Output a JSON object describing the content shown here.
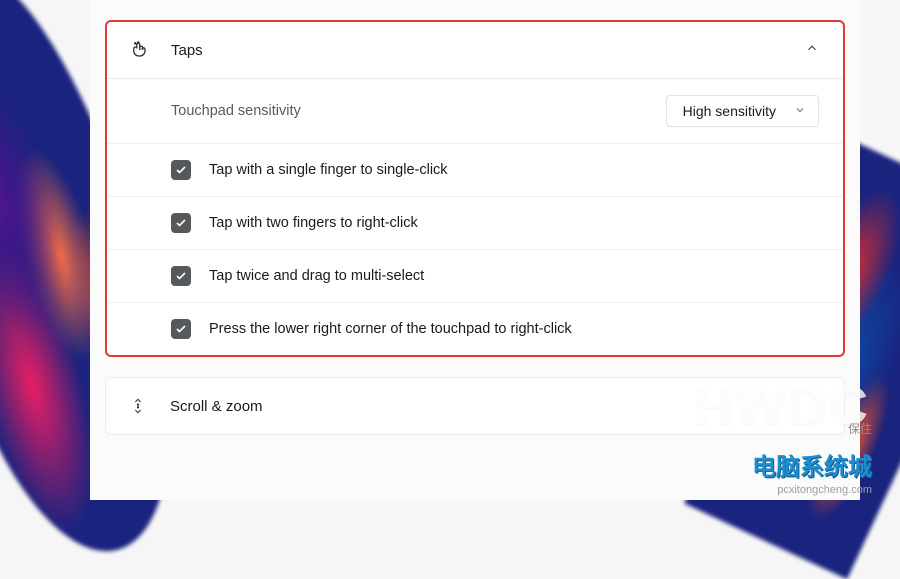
{
  "sections": {
    "taps": {
      "title": "Taps",
      "sensitivity": {
        "label": "Touchpad sensitivity",
        "selected": "High sensitivity"
      },
      "options": [
        {
          "label": "Tap with a single finger to single-click",
          "checked": true
        },
        {
          "label": "Tap with two fingers to right-click",
          "checked": true
        },
        {
          "label": "Tap twice and drag to multi-select",
          "checked": true
        },
        {
          "label": "Press the lower right corner of the touchpad to right-click",
          "checked": true
        }
      ]
    },
    "scroll": {
      "title": "Scroll & zoom"
    }
  },
  "watermark": {
    "big": "HWDC",
    "cn": "电脑系统城",
    "url": "pcxitongcheng.com",
    "badge": "保住"
  },
  "colors": {
    "highlight_border": "#e53935",
    "checkbox_bg": "#56595c"
  }
}
